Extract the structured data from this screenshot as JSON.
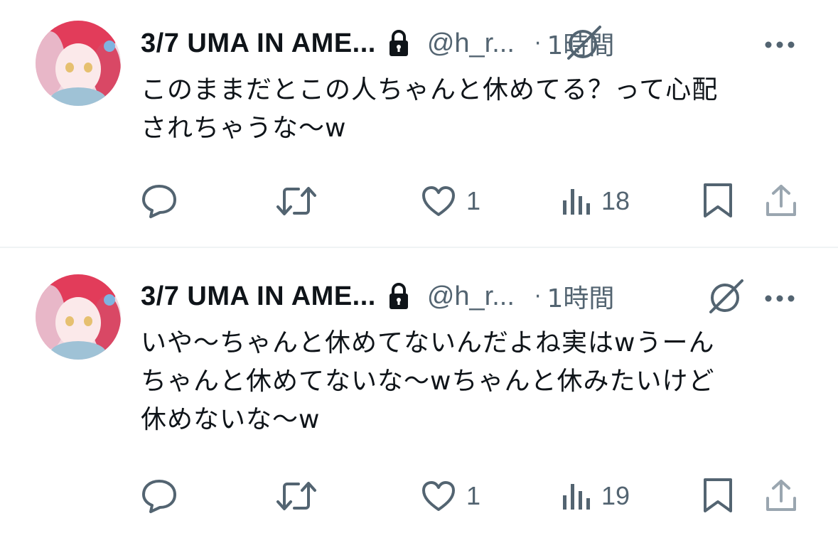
{
  "colors": {
    "text": "#0f1419",
    "secondary": "#536471",
    "divider": "#eff3f4"
  },
  "tweets": [
    {
      "display_name": "3/7 UMA IN AME...",
      "handle": "@h_r...",
      "dot": "·",
      "time": "1時間",
      "text": "このままだとこの人ちゃんと休めてる？って心配\nされちゃうな〜w",
      "reply_count": "",
      "retweet_count": "",
      "like_count": "1",
      "view_count": "18",
      "icons": [
        "lock-icon",
        "grok-icon",
        "more-icon",
        "reply-icon",
        "retweet-icon",
        "like-icon",
        "views-icon",
        "bookmark-icon",
        "share-icon"
      ]
    },
    {
      "display_name": "3/7 UMA IN AME...",
      "handle": "@h_r...",
      "dot": "·",
      "time": "1時間",
      "text": "いや〜ちゃんと休めてないんだよね実はwうーん\nちゃんと休めてないな〜wちゃんと休みたいけど\n休めないな〜w",
      "reply_count": "",
      "retweet_count": "",
      "like_count": "1",
      "view_count": "19",
      "icons": [
        "lock-icon",
        "grok-icon",
        "more-icon",
        "reply-icon",
        "retweet-icon",
        "like-icon",
        "views-icon",
        "bookmark-icon",
        "share-icon"
      ]
    }
  ]
}
